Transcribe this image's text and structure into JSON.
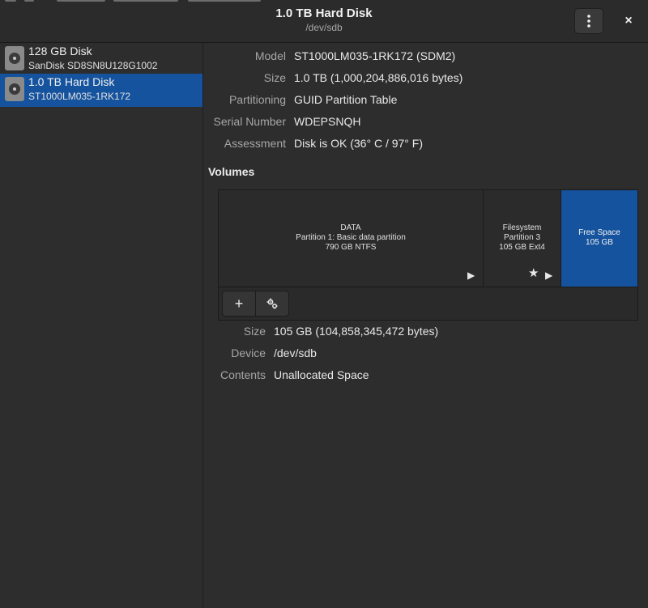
{
  "header": {
    "title": "1.0 TB Hard Disk",
    "subtitle": "/dev/sdb",
    "menu_icon": "vertical-dots-icon",
    "close_label": "×"
  },
  "sidebar": {
    "items": [
      {
        "name": "128 GB Disk",
        "model": "SanDisk SD8SN8U128G1002",
        "selected": false
      },
      {
        "name": "1.0 TB Hard Disk",
        "model": "ST1000LM035-1RK172",
        "selected": true
      }
    ]
  },
  "drive": {
    "model_label": "Model",
    "model": "ST1000LM035-1RK172 (SDM2)",
    "size_label": "Size",
    "size": "1.0 TB (1,000,204,886,016 bytes)",
    "partitioning_label": "Partitioning",
    "partitioning": "GUID Partition Table",
    "serial_label": "Serial Number",
    "serial": "WDEPSNQH",
    "assessment_label": "Assessment",
    "assessment": "Disk is OK (36° C / 97° F)"
  },
  "volumes": {
    "heading": "Volumes",
    "items": [
      {
        "line1": "DATA",
        "line2": "Partition 1: Basic data partition",
        "line3": "790 GB NTFS"
      },
      {
        "line1": "Filesystem",
        "line2": "Partition 3",
        "line3": "105 GB Ext4"
      },
      {
        "line1": "Free Space",
        "line2": "105 GB"
      }
    ],
    "add_label": "+",
    "selected_color": "#15539e"
  },
  "selected_volume": {
    "size_label": "Size",
    "size": "105 GB (104,858,345,472 bytes)",
    "device_label": "Device",
    "device": "/dev/sdb",
    "contents_label": "Contents",
    "contents": "Unallocated Space"
  }
}
